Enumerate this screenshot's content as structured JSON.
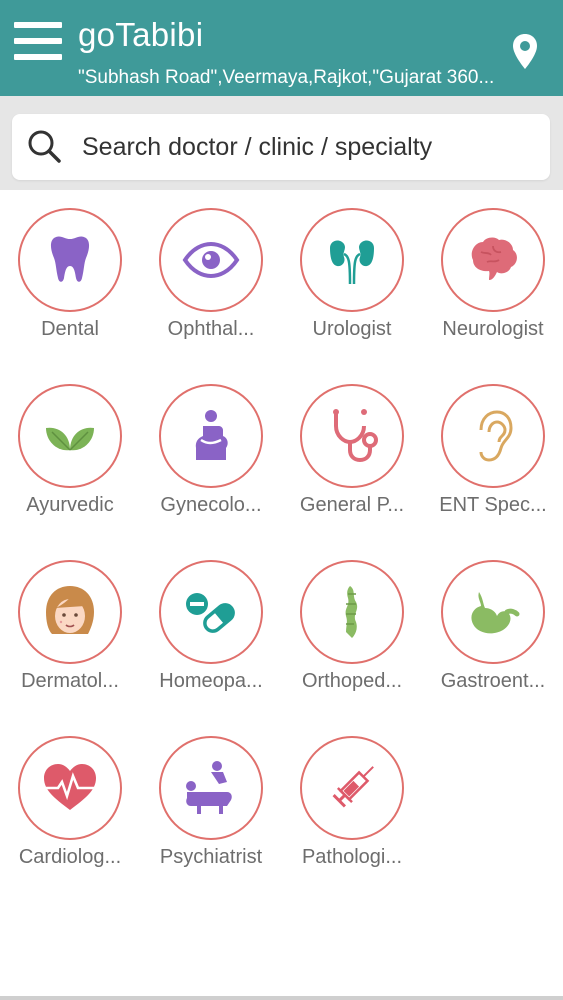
{
  "app": {
    "title": "goTabibi",
    "address": "\"Subhash Road\",Veermaya,Rajkot,\"Gujarat 360...",
    "theme_color": "#3f9a99"
  },
  "search": {
    "placeholder": "Search doctor / clinic / specialty"
  },
  "specialties": [
    {
      "label": "Dental",
      "icon": "tooth-icon"
    },
    {
      "label": "Ophthal...",
      "icon": "eye-icon"
    },
    {
      "label": "Urologist",
      "icon": "kidneys-icon"
    },
    {
      "label": "Neurologist",
      "icon": "brain-icon"
    },
    {
      "label": "Ayurvedic",
      "icon": "leaves-icon"
    },
    {
      "label": "Gynecolo...",
      "icon": "pregnant-woman-icon"
    },
    {
      "label": "General P...",
      "icon": "stethoscope-icon"
    },
    {
      "label": "ENT Spec...",
      "icon": "ear-icon"
    },
    {
      "label": "Dermatol...",
      "icon": "face-icon"
    },
    {
      "label": "Homeopa...",
      "icon": "pills-icon"
    },
    {
      "label": "Orthoped...",
      "icon": "spine-icon"
    },
    {
      "label": "Gastroent...",
      "icon": "stomach-icon"
    },
    {
      "label": "Cardiolog...",
      "icon": "heart-pulse-icon"
    },
    {
      "label": "Psychiatrist",
      "icon": "therapy-couch-icon"
    },
    {
      "label": "Pathologi...",
      "icon": "syringe-icon"
    }
  ],
  "colors": {
    "circle_border": "#e0706c",
    "label_text": "#6d6d6d"
  }
}
